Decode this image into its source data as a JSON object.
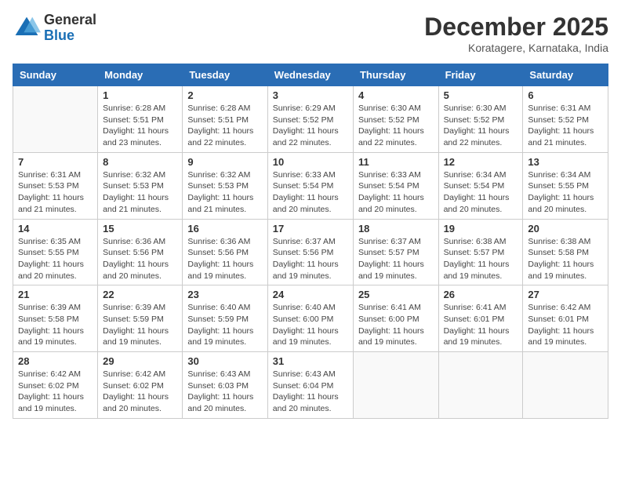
{
  "header": {
    "logo_general": "General",
    "logo_blue": "Blue",
    "month_title": "December 2025",
    "location": "Koratagere, Karnataka, India"
  },
  "weekdays": [
    "Sunday",
    "Monday",
    "Tuesday",
    "Wednesday",
    "Thursday",
    "Friday",
    "Saturday"
  ],
  "weeks": [
    [
      {
        "day": "",
        "info": ""
      },
      {
        "day": "1",
        "info": "Sunrise: 6:28 AM\nSunset: 5:51 PM\nDaylight: 11 hours\nand 23 minutes."
      },
      {
        "day": "2",
        "info": "Sunrise: 6:28 AM\nSunset: 5:51 PM\nDaylight: 11 hours\nand 22 minutes."
      },
      {
        "day": "3",
        "info": "Sunrise: 6:29 AM\nSunset: 5:52 PM\nDaylight: 11 hours\nand 22 minutes."
      },
      {
        "day": "4",
        "info": "Sunrise: 6:30 AM\nSunset: 5:52 PM\nDaylight: 11 hours\nand 22 minutes."
      },
      {
        "day": "5",
        "info": "Sunrise: 6:30 AM\nSunset: 5:52 PM\nDaylight: 11 hours\nand 22 minutes."
      },
      {
        "day": "6",
        "info": "Sunrise: 6:31 AM\nSunset: 5:52 PM\nDaylight: 11 hours\nand 21 minutes."
      }
    ],
    [
      {
        "day": "7",
        "info": "Sunrise: 6:31 AM\nSunset: 5:53 PM\nDaylight: 11 hours\nand 21 minutes."
      },
      {
        "day": "8",
        "info": "Sunrise: 6:32 AM\nSunset: 5:53 PM\nDaylight: 11 hours\nand 21 minutes."
      },
      {
        "day": "9",
        "info": "Sunrise: 6:32 AM\nSunset: 5:53 PM\nDaylight: 11 hours\nand 21 minutes."
      },
      {
        "day": "10",
        "info": "Sunrise: 6:33 AM\nSunset: 5:54 PM\nDaylight: 11 hours\nand 20 minutes."
      },
      {
        "day": "11",
        "info": "Sunrise: 6:33 AM\nSunset: 5:54 PM\nDaylight: 11 hours\nand 20 minutes."
      },
      {
        "day": "12",
        "info": "Sunrise: 6:34 AM\nSunset: 5:54 PM\nDaylight: 11 hours\nand 20 minutes."
      },
      {
        "day": "13",
        "info": "Sunrise: 6:34 AM\nSunset: 5:55 PM\nDaylight: 11 hours\nand 20 minutes."
      }
    ],
    [
      {
        "day": "14",
        "info": "Sunrise: 6:35 AM\nSunset: 5:55 PM\nDaylight: 11 hours\nand 20 minutes."
      },
      {
        "day": "15",
        "info": "Sunrise: 6:36 AM\nSunset: 5:56 PM\nDaylight: 11 hours\nand 20 minutes."
      },
      {
        "day": "16",
        "info": "Sunrise: 6:36 AM\nSunset: 5:56 PM\nDaylight: 11 hours\nand 19 minutes."
      },
      {
        "day": "17",
        "info": "Sunrise: 6:37 AM\nSunset: 5:56 PM\nDaylight: 11 hours\nand 19 minutes."
      },
      {
        "day": "18",
        "info": "Sunrise: 6:37 AM\nSunset: 5:57 PM\nDaylight: 11 hours\nand 19 minutes."
      },
      {
        "day": "19",
        "info": "Sunrise: 6:38 AM\nSunset: 5:57 PM\nDaylight: 11 hours\nand 19 minutes."
      },
      {
        "day": "20",
        "info": "Sunrise: 6:38 AM\nSunset: 5:58 PM\nDaylight: 11 hours\nand 19 minutes."
      }
    ],
    [
      {
        "day": "21",
        "info": "Sunrise: 6:39 AM\nSunset: 5:58 PM\nDaylight: 11 hours\nand 19 minutes."
      },
      {
        "day": "22",
        "info": "Sunrise: 6:39 AM\nSunset: 5:59 PM\nDaylight: 11 hours\nand 19 minutes."
      },
      {
        "day": "23",
        "info": "Sunrise: 6:40 AM\nSunset: 5:59 PM\nDaylight: 11 hours\nand 19 minutes."
      },
      {
        "day": "24",
        "info": "Sunrise: 6:40 AM\nSunset: 6:00 PM\nDaylight: 11 hours\nand 19 minutes."
      },
      {
        "day": "25",
        "info": "Sunrise: 6:41 AM\nSunset: 6:00 PM\nDaylight: 11 hours\nand 19 minutes."
      },
      {
        "day": "26",
        "info": "Sunrise: 6:41 AM\nSunset: 6:01 PM\nDaylight: 11 hours\nand 19 minutes."
      },
      {
        "day": "27",
        "info": "Sunrise: 6:42 AM\nSunset: 6:01 PM\nDaylight: 11 hours\nand 19 minutes."
      }
    ],
    [
      {
        "day": "28",
        "info": "Sunrise: 6:42 AM\nSunset: 6:02 PM\nDaylight: 11 hours\nand 19 minutes."
      },
      {
        "day": "29",
        "info": "Sunrise: 6:42 AM\nSunset: 6:02 PM\nDaylight: 11 hours\nand 20 minutes."
      },
      {
        "day": "30",
        "info": "Sunrise: 6:43 AM\nSunset: 6:03 PM\nDaylight: 11 hours\nand 20 minutes."
      },
      {
        "day": "31",
        "info": "Sunrise: 6:43 AM\nSunset: 6:04 PM\nDaylight: 11 hours\nand 20 minutes."
      },
      {
        "day": "",
        "info": ""
      },
      {
        "day": "",
        "info": ""
      },
      {
        "day": "",
        "info": ""
      }
    ]
  ]
}
